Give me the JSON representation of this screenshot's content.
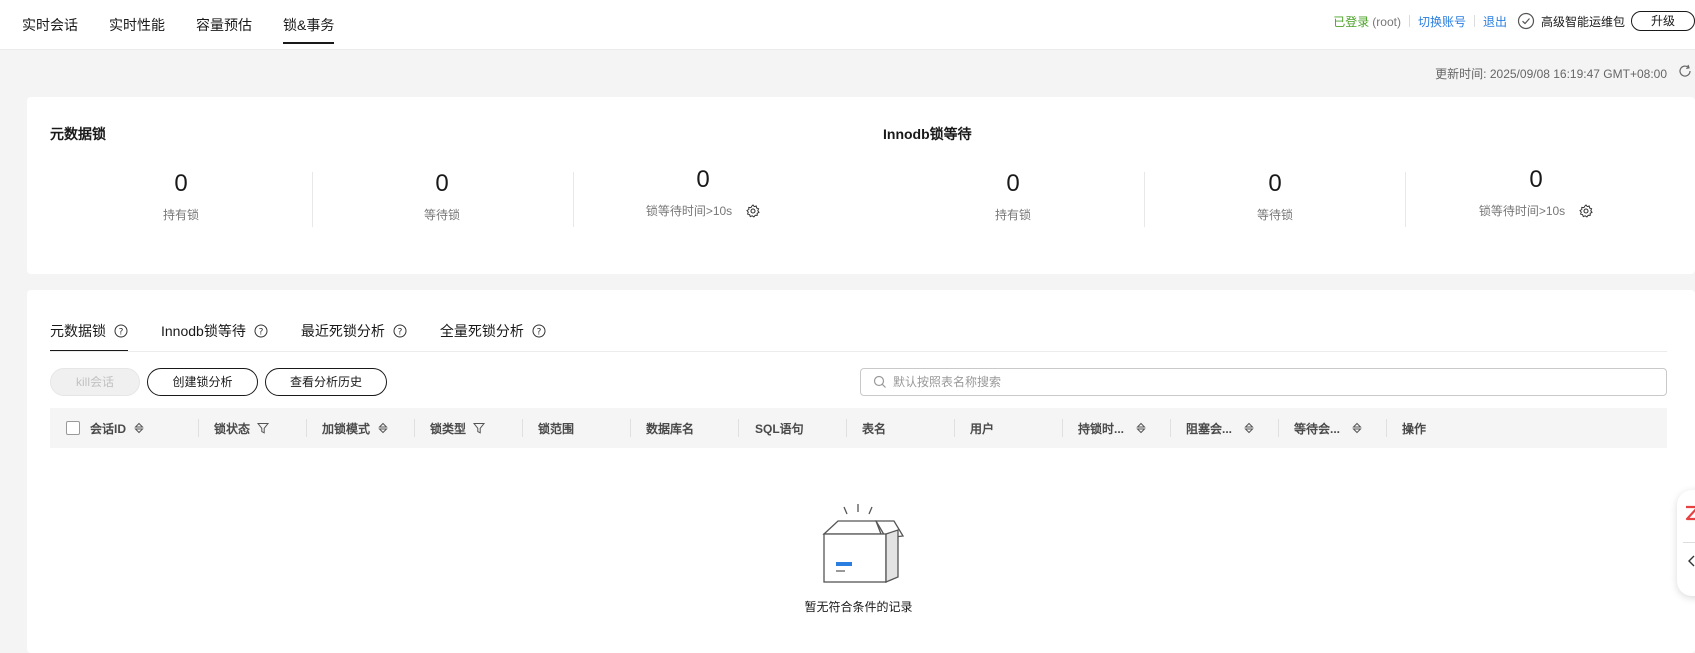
{
  "top_tabs": [
    {
      "label": "实时会话"
    },
    {
      "label": "实时性能"
    },
    {
      "label": "容量预估"
    },
    {
      "label": "锁&事务"
    }
  ],
  "header": {
    "logged_in": "已登录",
    "user": "(root)",
    "switch_account": "切换账号",
    "logout": "退出",
    "package": "高级智能运维包",
    "upgrade": "升级"
  },
  "update": {
    "label": "更新时间:",
    "time": "2025/09/08 16:19:47 GMT+08:00"
  },
  "metadata_lock": {
    "title": "元数据锁",
    "held": {
      "value": "0",
      "label": "持有锁"
    },
    "waiting": {
      "value": "0",
      "label": "等待锁"
    },
    "wait_over": {
      "value": "0",
      "label": "锁等待时间>10s"
    }
  },
  "innodb_lock": {
    "title": "Innodb锁等待",
    "held": {
      "value": "0",
      "label": "持有锁"
    },
    "waiting": {
      "value": "0",
      "label": "等待锁"
    },
    "wait_over": {
      "value": "0",
      "label": "锁等待时间>10s"
    }
  },
  "sub_tabs": [
    {
      "label": "元数据锁"
    },
    {
      "label": "Innodb锁等待"
    },
    {
      "label": "最近死锁分析"
    },
    {
      "label": "全量死锁分析"
    }
  ],
  "actions": {
    "kill": "kill会话",
    "create_analysis": "创建锁分析",
    "view_history": "查看分析历史"
  },
  "search": {
    "placeholder": "默认按照表名称搜索"
  },
  "table": {
    "columns": [
      {
        "label": "会话ID",
        "icon": "sort-icon"
      },
      {
        "label": "锁状态",
        "icon": "filter-icon"
      },
      {
        "label": "加锁模式",
        "icon": "sort-icon"
      },
      {
        "label": "锁类型",
        "icon": "filter-icon"
      },
      {
        "label": "锁范围",
        "icon": ""
      },
      {
        "label": "数据库名",
        "icon": ""
      },
      {
        "label": "SQL语句",
        "icon": ""
      },
      {
        "label": "表名",
        "icon": ""
      },
      {
        "label": "用户",
        "icon": ""
      },
      {
        "label": "持锁时...",
        "icon": "sort-icon"
      },
      {
        "label": "阻塞会...",
        "icon": "sort-icon"
      },
      {
        "label": "等待会...",
        "icon": "sort-icon"
      },
      {
        "label": "操作",
        "icon": ""
      }
    ],
    "empty_text": "暂无符合条件的记录"
  },
  "colors": {
    "logged_green": "#4ca22a",
    "link_blue": "#2a7ee0",
    "text": "#191919",
    "background": "#f4f4f4"
  }
}
